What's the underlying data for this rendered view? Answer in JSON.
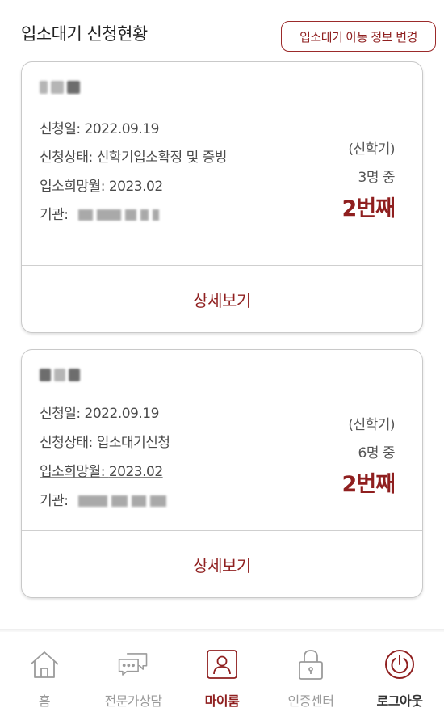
{
  "header": {
    "title": "입소대기 신청현황",
    "change_button": "입소대기 아동 정보 변경"
  },
  "cards": [
    {
      "apply_date": "신청일: 2022.09.19",
      "status": "신청상태: 신학기입소확정 및 증빙",
      "desired_month": "입소희망월: 2023.02",
      "org_label": "기관:",
      "term": "(신학기)",
      "waiting_count": "3명 중",
      "rank": "2번째",
      "detail": "상세보기"
    },
    {
      "apply_date": "신청일: 2022.09.19",
      "status": "신청상태: 입소대기신청",
      "desired_month_label": "입소희망월: ",
      "desired_month_value": "2023.02",
      "org_label": "기관:",
      "term": "(신학기)",
      "waiting_count": "6명 중",
      "rank": "2번째",
      "detail": "상세보기"
    }
  ],
  "nav": {
    "items": [
      {
        "label": "홈",
        "icon": "home-icon"
      },
      {
        "label": "전문가상담",
        "icon": "chat-icon"
      },
      {
        "label": "마이룸",
        "icon": "person-icon"
      },
      {
        "label": "인증센터",
        "icon": "lock-icon"
      },
      {
        "label": "로그아웃",
        "icon": "power-icon"
      }
    ]
  },
  "colors": {
    "accent": "#8f1f1f",
    "inactive": "#9b9b9b"
  }
}
